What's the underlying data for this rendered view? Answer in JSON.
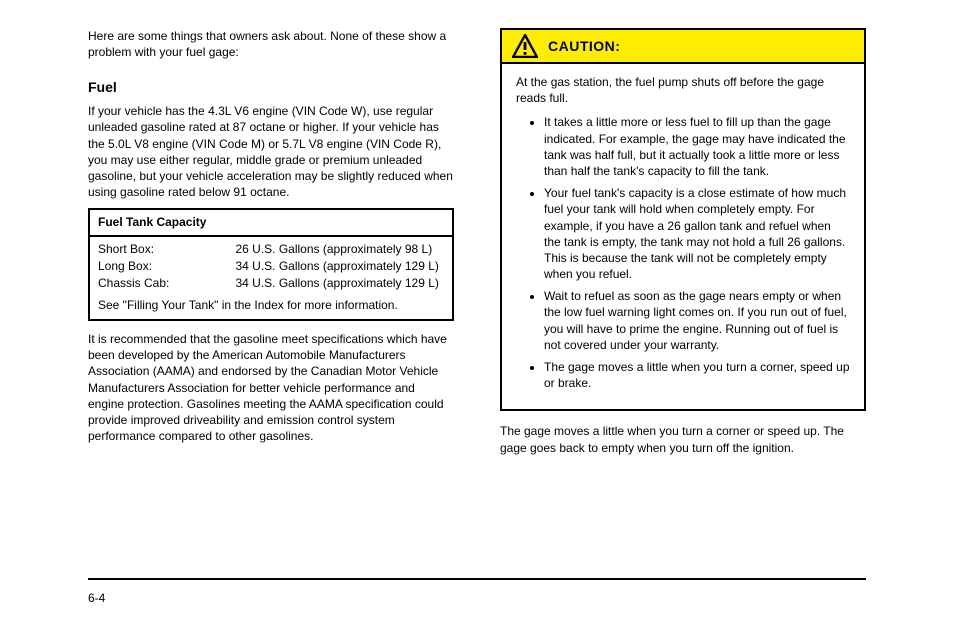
{
  "intro": "Here are some things that owners ask about. None of these show a problem with your fuel gage:",
  "section": {
    "heading": "Fuel",
    "p1": "If your vehicle has the 4.3L V6 engine (VIN Code W), use regular unleaded gasoline rated at 87 octane or higher. If your vehicle has the 5.0L V8 engine (VIN Code M) or 5.7L V8 engine (VIN Code R), you may use either regular, middle grade or premium unleaded gasoline, but your vehicle acceleration may be slightly reduced when using gasoline rated below 91 octane.",
    "p2": "It is recommended that the gasoline meet specifications which have been developed by the American Automobile Manufacturers Association (AAMA) and endorsed by the Canadian Motor Vehicle Manufacturers Association for better vehicle performance and engine protection. Gasolines meeting the AAMA specification could provide improved driveability and emission control system performance compared to other gasolines."
  },
  "fuel_table": {
    "head": "Fuel Tank Capacity",
    "rows": [
      {
        "label": "Short Box:",
        "value": "26 U.S. Gallons (approximately 98 L)"
      },
      {
        "label": "Long Box:",
        "value": "34 U.S. Gallons (approximately 129 L)"
      },
      {
        "label": "Chassis Cab:",
        "value": "34 U.S. Gallons (approximately 129 L)"
      }
    ],
    "note": "See \"Filling Your Tank\" in the Index for more information."
  },
  "caution": {
    "title": "CAUTION:",
    "lead": "At the gas station, the fuel pump shuts off before the gage reads full.",
    "items": [
      "It takes a little more or less fuel to fill up than the gage indicated. For example, the gage may have indicated the tank was half full, but it actually took a little more or less than half the tank's capacity to fill the tank.",
      "Your fuel tank's capacity is a close estimate of how much fuel your tank will hold when completely empty. For example, if you have a 26 gallon tank and refuel when the tank is empty, the tank may not hold a full 26 gallons. This is because the tank will not be completely empty when you refuel.",
      "Wait to refuel as soon as the gage nears empty or when the low fuel warning light comes on. If you run out of fuel, you will have to prime the engine. Running out of fuel is not covered under your warranty.",
      "The gage moves a little when you turn a corner, speed up or brake."
    ]
  },
  "right_below": "The gage moves a little when you turn a corner or speed up. The gage goes back to empty when you turn off the ignition.",
  "page_left": "6-4",
  "page_right": ""
}
